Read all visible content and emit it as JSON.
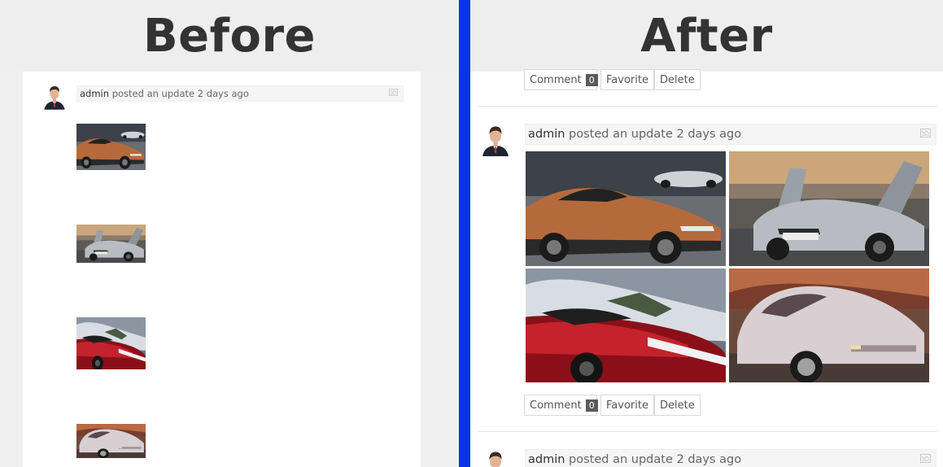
{
  "before": {
    "title": "Before",
    "post": {
      "user": "admin",
      "action": " posted an update 2 days ago",
      "avatar_icon": "user-avatar",
      "flag_icon": "flag-icon"
    }
  },
  "after": {
    "title": "After",
    "top_actions": {
      "comment_label": "Comment",
      "comment_count": "0",
      "favorite_label": "Favorite",
      "delete_label": "Delete"
    },
    "post": {
      "user": "admin",
      "action": " posted an update 2 days ago",
      "actions": {
        "comment_label": "Comment",
        "comment_count": "0",
        "favorite_label": "Favorite",
        "delete_label": "Delete"
      }
    },
    "next_post": {
      "user": "admin",
      "action": " posted an update 2 days ago"
    }
  },
  "gallery": [
    {
      "subject": "orange roadster photo"
    },
    {
      "subject": "silver sports car photo"
    },
    {
      "subject": "red race car photo"
    },
    {
      "subject": "classic silver coupe photo"
    }
  ],
  "colors": {
    "divider": "#0a34e8",
    "header_bg": "#eeeeee",
    "header_text": "#333333",
    "count_badge": "#5b5b5b"
  }
}
